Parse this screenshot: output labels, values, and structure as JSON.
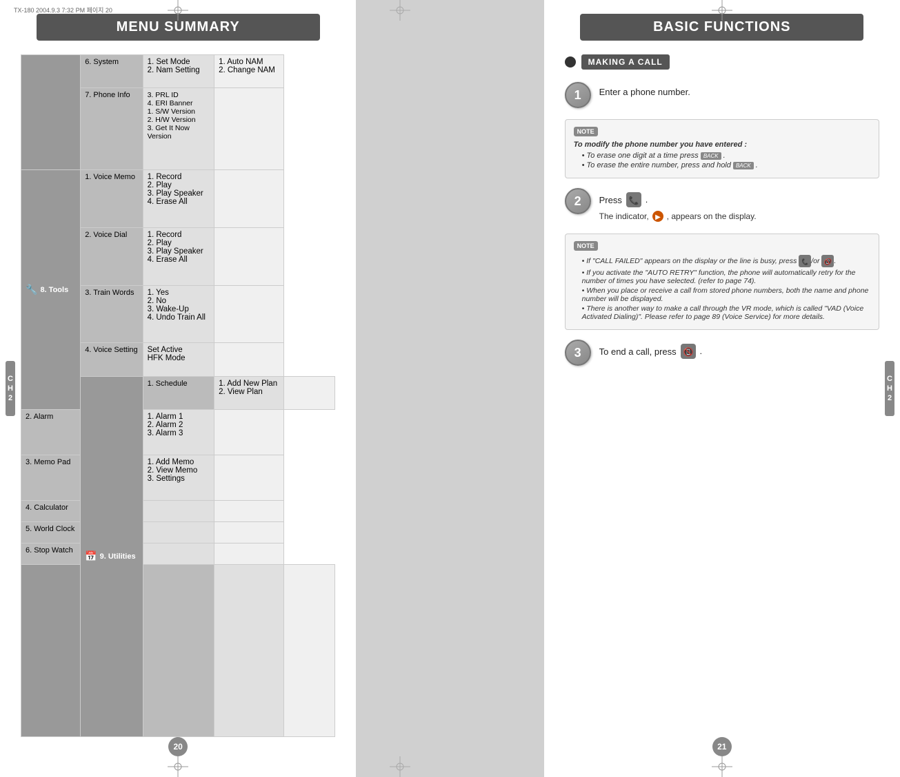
{
  "leftPage": {
    "fileHeader": "TX-180  2004.9.3 7:32 PM  페이지  20",
    "title": "MENU SUMMARY",
    "pageNumber": "20",
    "ch2": "CH\n2",
    "table": {
      "sections": [
        {
          "mainLabel": "8. Tools",
          "hasIcon": true,
          "iconSymbol": "🔧",
          "subItems": [
            {
              "sub": "1. Voice Memo",
              "items": [
                "1. Record",
                "2. Play",
                "3. Play Speaker",
                "4. Erase All"
              ]
            },
            {
              "sub": "2. Voice Dial",
              "items": [
                "1. Record",
                "2. Play",
                "3. Play Speaker",
                "4. Erase All"
              ]
            },
            {
              "sub": "3. Train Words",
              "items": [
                "1. Yes",
                "2. No",
                "3. Wake-Up",
                "4. Undo Train All"
              ]
            },
            {
              "sub": "4. Voice Setting",
              "items": [
                "Set Active",
                "HFK Mode"
              ]
            }
          ]
        },
        {
          "mainLabel": "9. Utilities",
          "hasIcon": true,
          "iconSymbol": "📅",
          "subItems": [
            {
              "sub": "1. Schedule",
              "items": [
                "1. Add New Plan",
                "2. View Plan"
              ]
            },
            {
              "sub": "2. Alarm",
              "items": [
                "1. Alarm 1",
                "2. Alarm 2",
                "3. Alarm 3"
              ]
            },
            {
              "sub": "3. Memo Pad",
              "items": [
                "1. Add Memo",
                "2. View Memo",
                "3. Settings"
              ]
            },
            {
              "sub": "4. Calculator",
              "items": []
            },
            {
              "sub": "5. World Clock",
              "items": []
            },
            {
              "sub": "6. Stop Watch",
              "items": []
            }
          ]
        }
      ],
      "extraSections": [
        {
          "mainLabel": "6. System",
          "items": [
            "1. Set Mode",
            "2. Nam Setting"
          ],
          "subItems": [
            "1. Auto NAM",
            "2. Change NAM"
          ]
        },
        {
          "mainLabel": "7. Phone Info",
          "items": [
            "3. PRL ID",
            "4. ERI Banner",
            "1. S/W Version",
            "2. H/W Version",
            "3. Get It Now Version"
          ],
          "subItems": []
        }
      ]
    }
  },
  "rightPage": {
    "title": "BASIC FUNCTIONS",
    "pageNumber": "21",
    "ch2": "CH\n2",
    "makingACall": "MAKING A CALL",
    "steps": [
      {
        "number": "1",
        "text": "Enter a phone number."
      },
      {
        "number": "2",
        "text": "Press",
        "subText": "The indicator,",
        "subText2": ", appears on the display."
      },
      {
        "number": "3",
        "text": "To end a call, press"
      }
    ],
    "note1": {
      "label": "NOTE",
      "title": "To modify the phone number you have entered :",
      "bullets": [
        "To erase one digit at a time press       .",
        "To erase the entire number, press and hold       ."
      ]
    },
    "note2": {
      "label": "NOTE",
      "bullets": [
        "If \"CALL FAILED\" appears on the display or the line is busy, press      /or       .",
        "If you activate the \"AUTO RETRY\" function, the phone will automatically retry for the number of times you have selected. (refer to page 74).",
        "When you place or receive a call from stored phone numbers, both the name and phone number will be displayed.",
        "There is another way to make a call through the VR mode, which is called \"VAD (Voice Activated Dialing)\". Please refer to page 89 (Voice Service) for more details."
      ]
    }
  }
}
